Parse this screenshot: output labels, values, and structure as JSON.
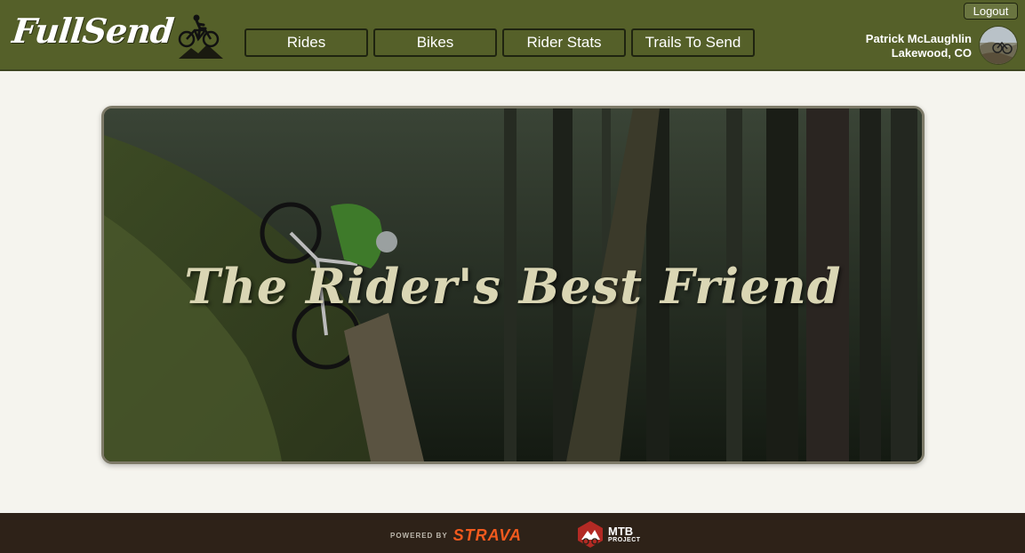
{
  "header": {
    "logo_text": "FullSend",
    "logout_label": "Logout",
    "user_name": "Patrick McLaughlin",
    "user_location": "Lakewood, CO",
    "nav": [
      {
        "label": "Rides"
      },
      {
        "label": "Bikes"
      },
      {
        "label": "Rider Stats"
      },
      {
        "label": "Trails To Send"
      }
    ]
  },
  "hero": {
    "title": "The Rider's Best Friend"
  },
  "footer": {
    "powered_by": "POWERED BY",
    "strava": "STRAVA",
    "mtb_line1": "MTB",
    "mtb_line2": "PROJECT"
  },
  "colors": {
    "header_bg": "#556029",
    "page_bg": "#f5f4ee",
    "footer_bg": "#2e2218",
    "strava_orange": "#f25a1e",
    "hero_title": "#dad6b4"
  },
  "icons": [
    "mountain-biker-icon",
    "avatar-photo",
    "mtb-project-icon"
  ]
}
